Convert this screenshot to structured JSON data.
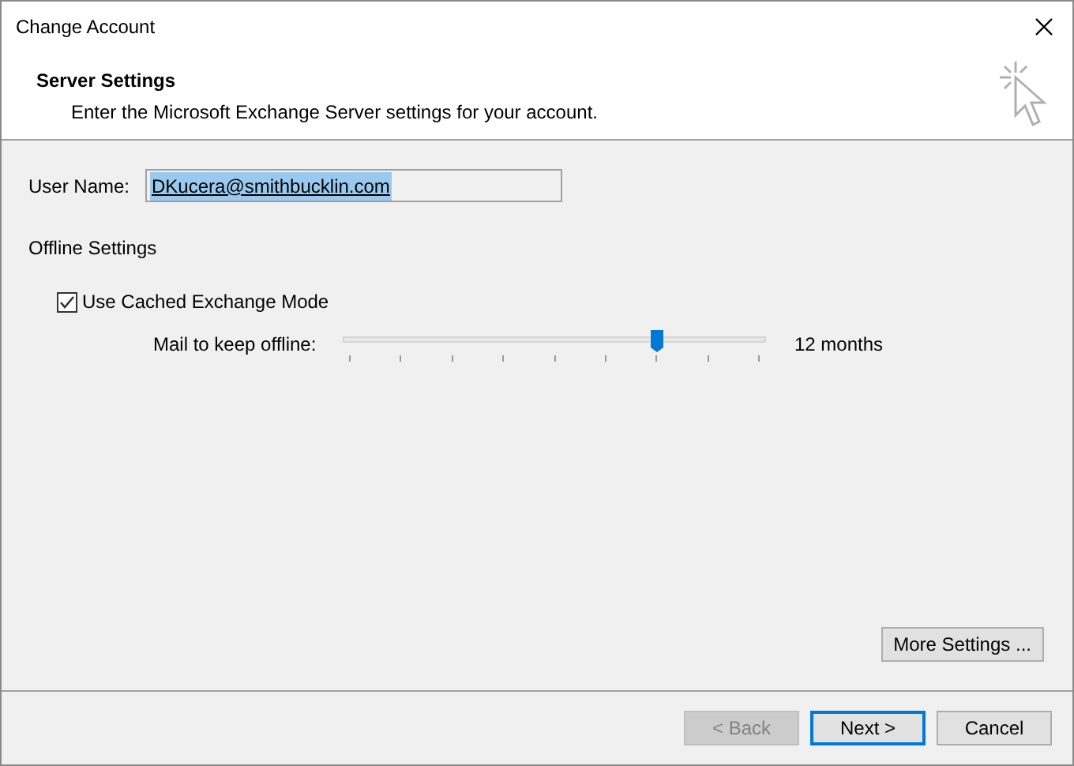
{
  "window": {
    "title": "Change Account"
  },
  "header": {
    "title": "Server Settings",
    "subtitle": "Enter the Microsoft Exchange Server settings for your account."
  },
  "user_name": {
    "label": "User Name:",
    "value": "DKucera@smithbucklin.com"
  },
  "offline_settings": {
    "heading": "Offline Settings",
    "cached_mode": {
      "label": "Use Cached Exchange Mode",
      "checked": true
    },
    "mail_to_keep": {
      "label": "Mail to keep offline:",
      "level": 0.75,
      "reading": "12 months"
    }
  },
  "more_settings_button": "More Settings ...",
  "buttons": [
    {
      "label": "< Back",
      "disabled": true,
      "focused": false
    },
    {
      "label": "Next >",
      "disabled": false,
      "focused": true
    },
    {
      "label": "Cancel",
      "disabled": false,
      "focused": false
    }
  ]
}
